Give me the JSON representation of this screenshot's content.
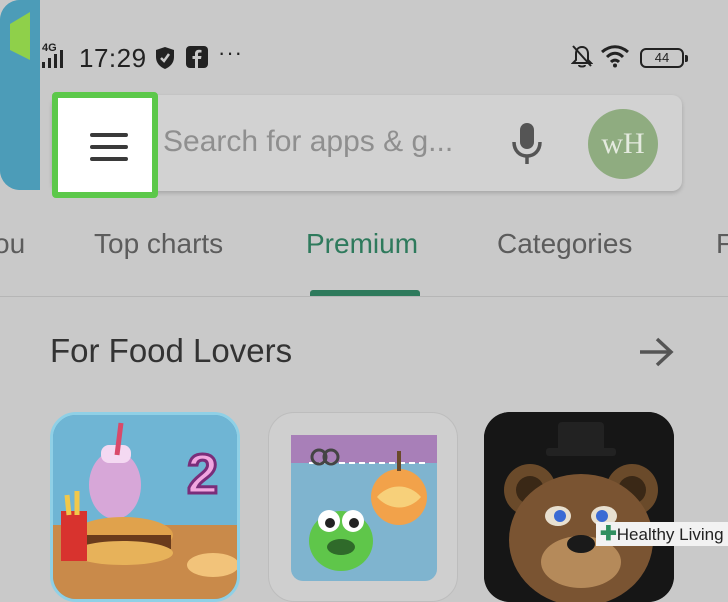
{
  "status_bar": {
    "network": "4G",
    "time": "17:29",
    "more": "···",
    "battery": "44",
    "icons": [
      "signal-icon",
      "shield-icon",
      "facebook-icon",
      "mute-bell-icon",
      "wifi-icon",
      "battery-icon"
    ]
  },
  "search": {
    "menu_icon": "hamburger-menu-icon",
    "placeholder": "Search for apps & g...",
    "mic_icon": "microphone-icon",
    "avatar_initials": "wH"
  },
  "tabs": {
    "items": [
      {
        "label": "ou"
      },
      {
        "label": "Top charts"
      },
      {
        "label": "Premium",
        "active": true
      },
      {
        "label": "Categories"
      },
      {
        "label": "F"
      }
    ],
    "active_color": "#2e7a5c"
  },
  "section": {
    "title": "For Food Lovers",
    "arrow_icon": "arrow-right-icon"
  },
  "apps": [
    {
      "name": "cooking-game-app",
      "badge": "2"
    },
    {
      "name": "cut-the-rope-app"
    },
    {
      "name": "five-nights-at-freddys-app"
    },
    {
      "name": "partial-app"
    }
  ],
  "highlight_color": "#5cc84a",
  "watermark": {
    "text": "Healthy Living"
  }
}
